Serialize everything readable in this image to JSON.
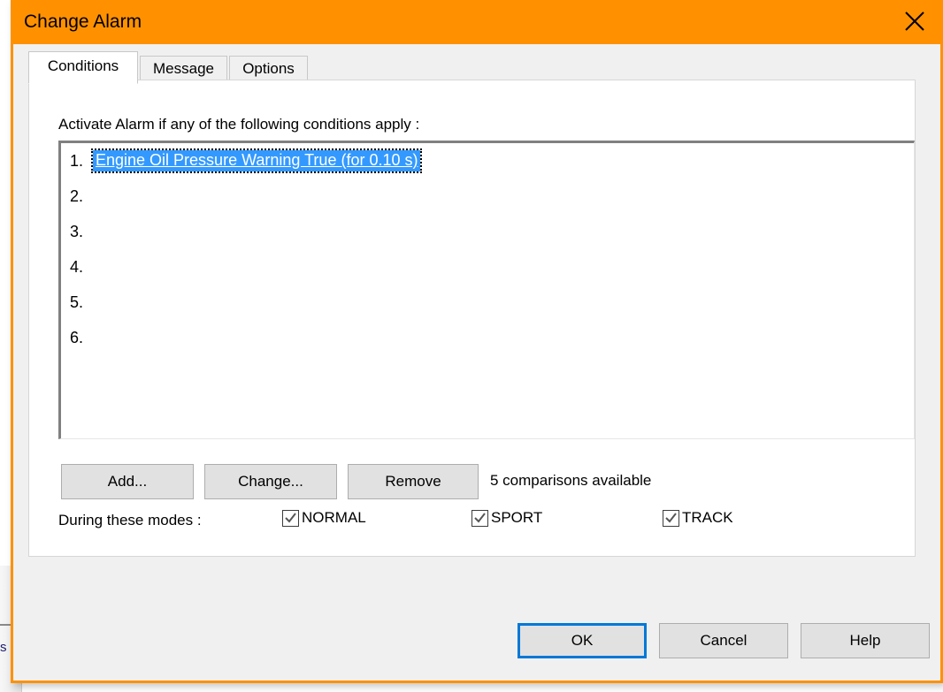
{
  "window": {
    "title": "Change Alarm",
    "close_icon": "close-x-icon",
    "accent_color": "#ff9100",
    "body_color": "#f0f0f0"
  },
  "tabs": [
    {
      "label": "Conditions",
      "selected": true
    },
    {
      "label": "Message",
      "selected": false
    },
    {
      "label": "Options",
      "selected": false
    }
  ],
  "conditions_tab": {
    "caption": "Activate Alarm if any of the following conditions apply :",
    "rows": [
      {
        "index": "1.",
        "text": "Engine Oil Pressure Warning True (for 0.10 s)",
        "selected": true
      },
      {
        "index": "2.",
        "text": "",
        "selected": false
      },
      {
        "index": "3.",
        "text": "",
        "selected": false
      },
      {
        "index": "4.",
        "text": "",
        "selected": false
      },
      {
        "index": "5.",
        "text": "",
        "selected": false
      },
      {
        "index": "6.",
        "text": "",
        "selected": false
      }
    ],
    "selection_color": "#3399ff",
    "buttons": {
      "add": "Add...",
      "change": "Change...",
      "remove": "Remove"
    },
    "comparisons_status": "5 comparisons available",
    "modes_label": "During these modes :",
    "modes": [
      {
        "label": "NORMAL",
        "checked": true
      },
      {
        "label": "SPORT",
        "checked": true
      },
      {
        "label": "TRACK",
        "checked": true
      }
    ]
  },
  "footer": {
    "ok": "OK",
    "cancel": "Cancel",
    "help": "Help",
    "focus_color": "#0078d7"
  },
  "background": {
    "fragment_text": "s"
  }
}
